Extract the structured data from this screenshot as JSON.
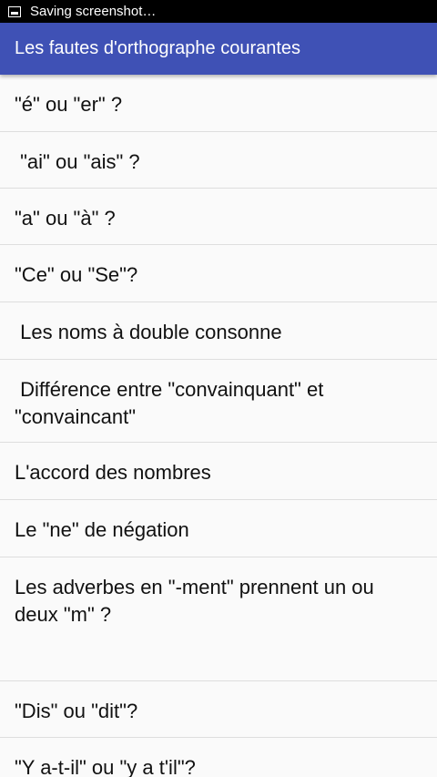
{
  "status_bar": {
    "icon": "screenshot-icon",
    "text": "Saving screenshot…"
  },
  "app_bar": {
    "title": "Les fautes d'orthographe courantes"
  },
  "list": {
    "items": [
      {
        "label": "\"é\" ou \"er\" ?"
      },
      {
        "label": " \"ai\" ou \"ais\" ?"
      },
      {
        "label": "\"a\" ou \"à\" ?"
      },
      {
        "label": "\"Ce\" ou \"Se\"?"
      },
      {
        "label": " Les noms à double consonne"
      },
      {
        "label": " Différence entre \"convainquant\" et \"convaincant\""
      },
      {
        "label": "L'accord des nombres"
      },
      {
        "label": "Le \"ne\" de négation"
      },
      {
        "label": "Les adverbes en \"-ment\" prennent un ou deux \"m\" ?"
      },
      {
        "label": "\"Dis\" ou \"dit\"?"
      },
      {
        "label": "\"Y a-t-il\" ou \"y a t'il\"?"
      }
    ]
  }
}
